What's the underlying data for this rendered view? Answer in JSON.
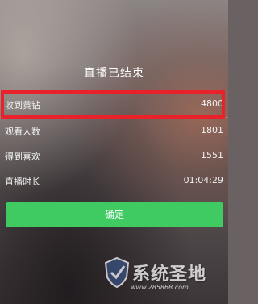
{
  "title": "直播已结束",
  "stats": [
    {
      "label": "收到黄钻",
      "value": "4800"
    },
    {
      "label": "观看人数",
      "value": "1801"
    },
    {
      "label": "得到喜欢",
      "value": "1551"
    },
    {
      "label": "直播时长",
      "value": "01:04:29"
    }
  ],
  "confirm_label": "确定",
  "watermark": {
    "name": "系统圣地",
    "url": "www.285868.com"
  },
  "colors": {
    "highlight": "#e8212b",
    "confirm_button": "#3fcb62"
  }
}
